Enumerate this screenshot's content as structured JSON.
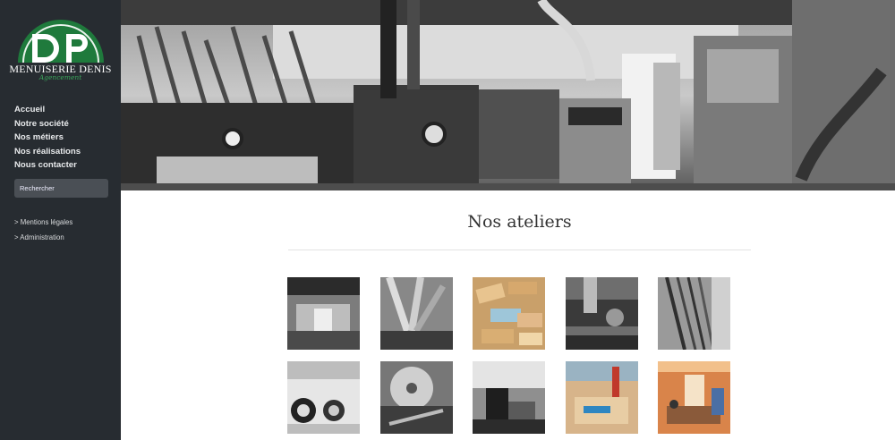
{
  "brand": {
    "name": "MENUISERIE DENIS",
    "tagline": "Agencement",
    "initials": "DP"
  },
  "nav": [
    {
      "label": "Accueil"
    },
    {
      "label": "Notre société"
    },
    {
      "label": "Nos métiers"
    },
    {
      "label": "Nos réalisations"
    },
    {
      "label": "Nous contacter"
    }
  ],
  "search": {
    "placeholder": "Rechercher"
  },
  "legal_links": [
    {
      "label": "> Mentions légales"
    },
    {
      "label": "> Administration"
    }
  ],
  "page": {
    "title": "Nos ateliers"
  },
  "colors": {
    "sidebar_bg": "#272c31",
    "logo_green": "#1f7a3c",
    "accent_green": "#3aa35a"
  },
  "banner": {
    "name": "workshop-banner-photo",
    "style": "black-and-white"
  },
  "gallery": [
    {
      "name": "workshop-hall-photo",
      "tone": "bw"
    },
    {
      "name": "dust-extraction-pipes-photo",
      "tone": "bw"
    },
    {
      "name": "wood-blocks-photo",
      "tone": "color"
    },
    {
      "name": "machine-closeup-photo",
      "tone": "bw"
    },
    {
      "name": "lumber-rack-photo",
      "tone": "bw"
    },
    {
      "name": "machine-rollers-photo",
      "tone": "bw"
    },
    {
      "name": "saw-blade-photo",
      "tone": "bw"
    },
    {
      "name": "router-machine-photo",
      "tone": "bw"
    },
    {
      "name": "workbench-clamps-photo",
      "tone": "color"
    },
    {
      "name": "office-interior-photo",
      "tone": "color"
    }
  ]
}
